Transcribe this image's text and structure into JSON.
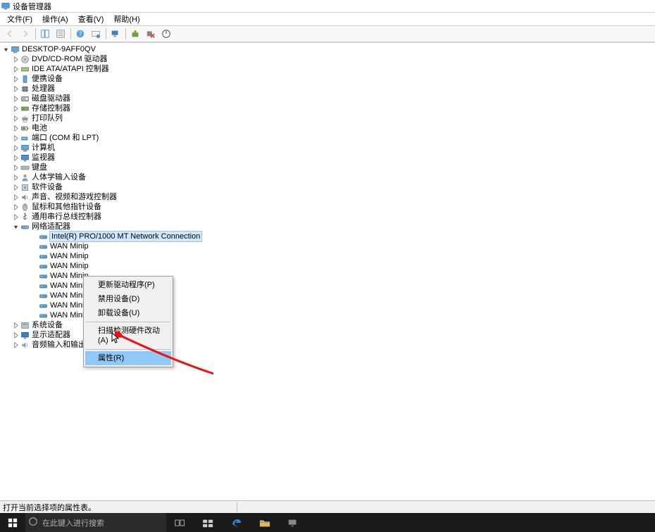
{
  "window": {
    "title": "设备管理器"
  },
  "menu": {
    "file": "文件(F)",
    "action": "操作(A)",
    "view": "查看(V)",
    "help": "帮助(H)"
  },
  "tree": {
    "root": "DESKTOP-9AFF0QV",
    "nodes": [
      {
        "label": "DVD/CD-ROM 驱动器",
        "icon": "disc"
      },
      {
        "label": "IDE ATA/ATAPI 控制器",
        "icon": "ide"
      },
      {
        "label": "便携设备",
        "icon": "portable"
      },
      {
        "label": "处理器",
        "icon": "cpu"
      },
      {
        "label": "磁盘驱动器",
        "icon": "disk"
      },
      {
        "label": "存储控制器",
        "icon": "storage"
      },
      {
        "label": "打印队列",
        "icon": "printer"
      },
      {
        "label": "电池",
        "icon": "battery"
      },
      {
        "label": "端口 (COM 和 LPT)",
        "icon": "port"
      },
      {
        "label": "计算机",
        "icon": "computer"
      },
      {
        "label": "监视器",
        "icon": "monitor"
      },
      {
        "label": "键盘",
        "icon": "keyboard"
      },
      {
        "label": "人体学输入设备",
        "icon": "hid"
      },
      {
        "label": "软件设备",
        "icon": "software"
      },
      {
        "label": "声音、视频和游戏控制器",
        "icon": "audio"
      },
      {
        "label": "鼠标和其他指针设备",
        "icon": "mouse"
      },
      {
        "label": "通用串行总线控制器",
        "icon": "usb"
      }
    ],
    "network": {
      "label": "网络适配器",
      "children": [
        "Intel(R) PRO/1000 MT Network Connection",
        "WAN Minip",
        "WAN Minip",
        "WAN Minip",
        "WAN Minip",
        "WAN Minip",
        "WAN Minip",
        "WAN Miniport (PPTP)",
        "WAN Miniport (SSTP)"
      ]
    },
    "tail": [
      {
        "label": "系统设备",
        "icon": "system"
      },
      {
        "label": "显示适配器",
        "icon": "display"
      },
      {
        "label": "音频输入和输出",
        "icon": "audioio"
      }
    ]
  },
  "context_menu": {
    "update_driver": "更新驱动程序(P)",
    "disable_device": "禁用设备(D)",
    "uninstall_device": "卸载设备(U)",
    "scan_hardware": "扫描检测硬件改动(A)",
    "properties": "属性(R)"
  },
  "statusbar": {
    "text": "打开当前选择项的属性表。"
  },
  "taskbar": {
    "search_placeholder": "在此键入进行搜索"
  }
}
